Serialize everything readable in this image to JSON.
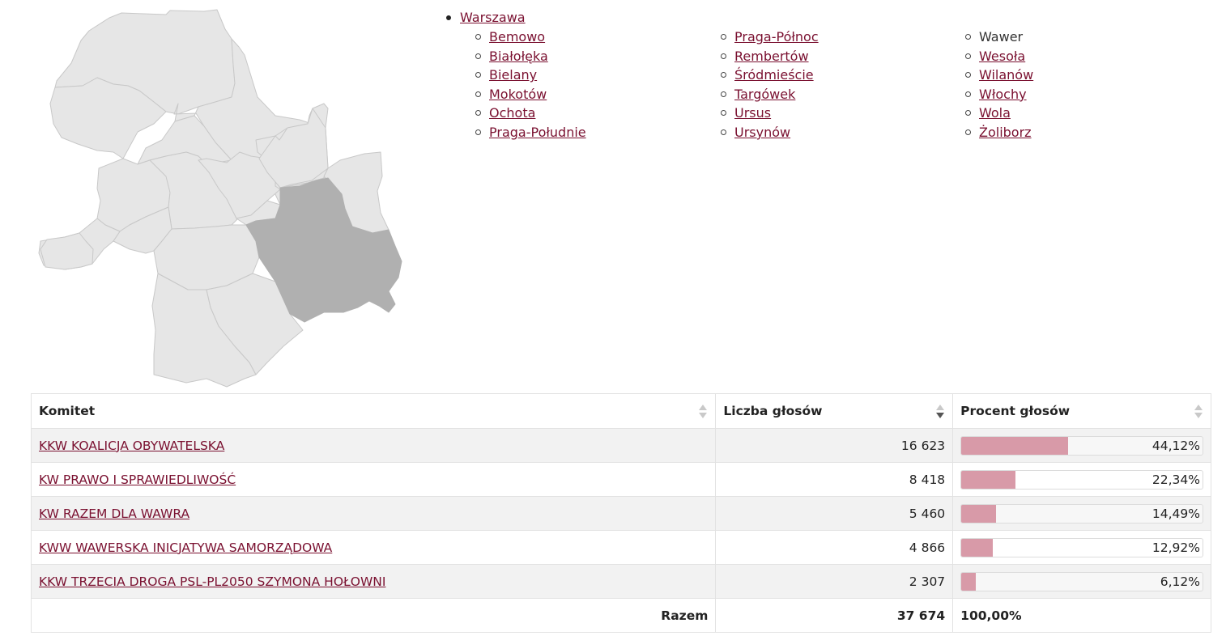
{
  "map": {
    "active_district": "Wawer"
  },
  "nav": {
    "city": "Warszawa",
    "districts_col1": [
      "Bemowo",
      "Białołęka",
      "Bielany",
      "Mokotów",
      "Ochota",
      "Praga-Południe"
    ],
    "districts_col2": [
      "Praga-Północ",
      "Rembertów",
      "Śródmieście",
      "Targówek",
      "Ursus",
      "Ursynów"
    ],
    "districts_col3": [
      "Wawer",
      "Wesoła",
      "Wilanów",
      "Włochy",
      "Wola",
      "Żoliborz"
    ]
  },
  "table": {
    "headers": {
      "committee": "Komitet",
      "votes": "Liczba głosów",
      "percent": "Procent głosów"
    },
    "rows": [
      {
        "committee": "KKW KOALICJA OBYWATELSKA",
        "votes": "16 623",
        "percent": "44,12%",
        "share": 0.4412
      },
      {
        "committee": "KW PRAWO I SPRAWIEDLIWOŚĆ",
        "votes": "8 418",
        "percent": "22,34%",
        "share": 0.2234
      },
      {
        "committee": "KW RAZEM DLA WAWRA",
        "votes": "5 460",
        "percent": "14,49%",
        "share": 0.1449
      },
      {
        "committee": "KWW WAWERSKA INICJATYWA SAMORZĄDOWA",
        "votes": "4 866",
        "percent": "12,92%",
        "share": 0.1292
      },
      {
        "committee": "KKW TRZECIA DROGA PSL-PL2050 SZYMONA HOŁOWNI",
        "votes": "2 307",
        "percent": "6,12%",
        "share": 0.0612
      }
    ],
    "total": {
      "label": "Razem",
      "votes": "37 674",
      "percent": "100,00%"
    }
  },
  "colors": {
    "link": "#7a1030",
    "bar_fill": "#d89aa8",
    "map_district": "#e6e6e6",
    "map_active": "#b0b0b0"
  }
}
